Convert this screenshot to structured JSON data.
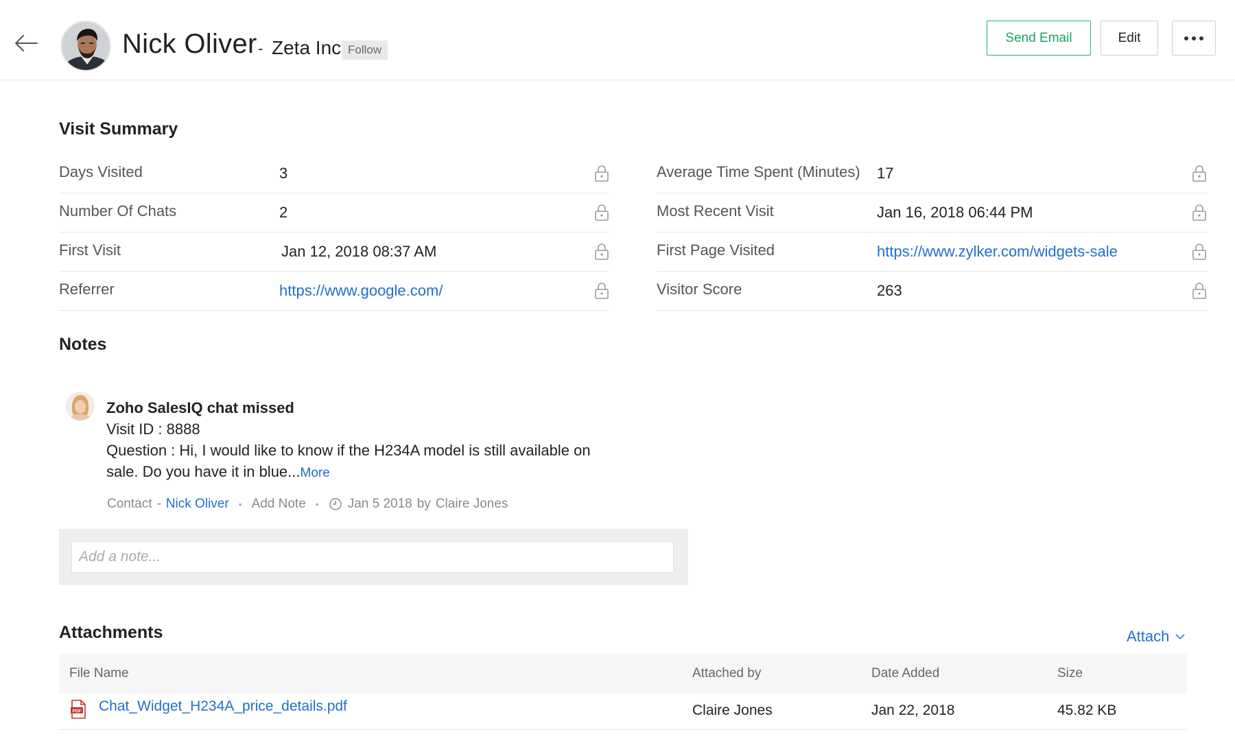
{
  "header": {
    "contact_name": "Nick Oliver",
    "separator": "-",
    "company": "Zeta Inc",
    "follow_label": "Follow",
    "send_email_label": "Send Email",
    "edit_label": "Edit",
    "accent_color": "#1aa461"
  },
  "visit_summary": {
    "title": "Visit Summary",
    "left_fields": [
      {
        "label": "Days Visited",
        "value": "3"
      },
      {
        "label": "Number Of Chats",
        "value": "2"
      },
      {
        "label": "First Visit",
        "value": "Jan 12, 2018 08:37 AM"
      },
      {
        "label": "Referrer",
        "value": "https://www.google.com/"
      }
    ],
    "right_fields": [
      {
        "label": "Average Time Spent (Minutes)",
        "value": "17"
      },
      {
        "label": "Most Recent Visit",
        "value": "Jan 16, 2018 06:44 PM"
      },
      {
        "label": "First Page Visited",
        "value": "https://www.zylker.com/widgets-sale"
      },
      {
        "label": "Visitor Score",
        "value": "263"
      }
    ]
  },
  "notes": {
    "title": "Notes",
    "note": {
      "title": "Zoho SalesIQ chat missed",
      "visit_line": "Visit ID : 8888",
      "question_line_1": "Question : Hi, I would like to know if the H234A model is still available on",
      "question_line_2": "sale. Do you have it in blue...",
      "more_label": "More",
      "meta_contact_prefix": "Contact",
      "meta_dash": "-",
      "meta_contact_name": "Nick Oliver",
      "meta_add_note": "Add Note",
      "meta_date": "Jan 5 2018",
      "meta_by": "by",
      "meta_author": "Claire Jones"
    },
    "add_note_placeholder": "Add a note..."
  },
  "attachments": {
    "title": "Attachments",
    "attach_label": "Attach",
    "columns": [
      "File Name",
      "Attached by",
      "Date Added",
      "Size"
    ],
    "rows": [
      {
        "file_name": "Chat_Widget_H234A_price_details.pdf",
        "attached_by": "Claire Jones",
        "date_added": "Jan 22, 2018",
        "size": "45.82 KB"
      }
    ]
  },
  "colors": {
    "link": "#1f6fcf",
    "send_email_border": "#22b573"
  }
}
